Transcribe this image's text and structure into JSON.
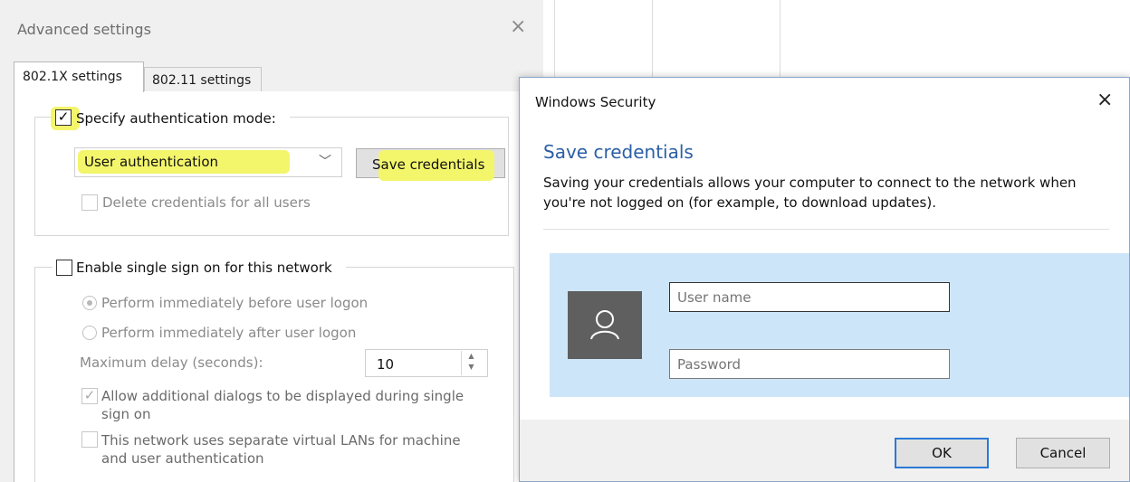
{
  "advanced": {
    "title": "Advanced settings",
    "close_icon": "×",
    "tabs": [
      {
        "label": "802.1X settings",
        "active": true
      },
      {
        "label": "802.11 settings",
        "active": false
      }
    ],
    "auth_mode": {
      "checkbox_label": "Specify authentication mode:",
      "checked": true,
      "select_value": "User authentication",
      "save_credentials_label": "Save credentials",
      "delete_credentials_label": "Delete credentials for all users"
    },
    "sso": {
      "checkbox_label": "Enable single sign on for this network",
      "checked": false,
      "radio_before": "Perform immediately before user logon",
      "radio_after": "Perform immediately after user logon",
      "delay_label": "Maximum delay (seconds):",
      "delay_value": "10",
      "allow_dialogs_line1": "Allow additional dialogs to be displayed during single",
      "allow_dialogs_line2": "sign on",
      "vlan_line1": "This network uses separate virtual LANs for machine",
      "vlan_line2": "and user authentication"
    },
    "highlight_color": "#f3f56b"
  },
  "security": {
    "title": "Windows Security",
    "close_icon": "×",
    "heading": "Save credentials",
    "description": "Saving your credentials allows your computer to connect to the network when you're not logged on (for example, to download updates).",
    "username_placeholder": "User name",
    "password_placeholder": "Password",
    "ok_label": "OK",
    "cancel_label": "Cancel",
    "accent_color": "#2b5fa6",
    "panel_color": "#cde5f8"
  }
}
